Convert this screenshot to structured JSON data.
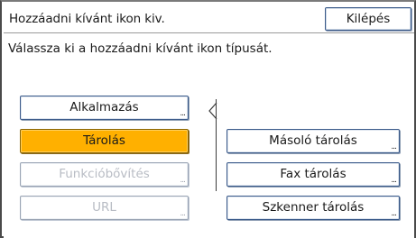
{
  "header": {
    "title": "Hozzáadni kívánt ikon kiv.",
    "exit_label": "Kilépés"
  },
  "instruction": "Válassza ki a hozzáadni kívánt ikon típusát.",
  "type_buttons": [
    {
      "label": "Alkalmazás",
      "state": "normal"
    },
    {
      "label": "Tárolás",
      "state": "selected"
    },
    {
      "label": "Funkcióbővítés",
      "state": "disabled"
    },
    {
      "label": "URL",
      "state": "disabled"
    }
  ],
  "storage_buttons": [
    {
      "label": "Másoló tárolás"
    },
    {
      "label": "Fax tárolás"
    },
    {
      "label": "Szkenner tárolás"
    }
  ],
  "more_indicator": "...",
  "colors": {
    "selected": "#ffb000",
    "border": "#3b5a8a",
    "disabled_text": "#b8bcc4"
  }
}
